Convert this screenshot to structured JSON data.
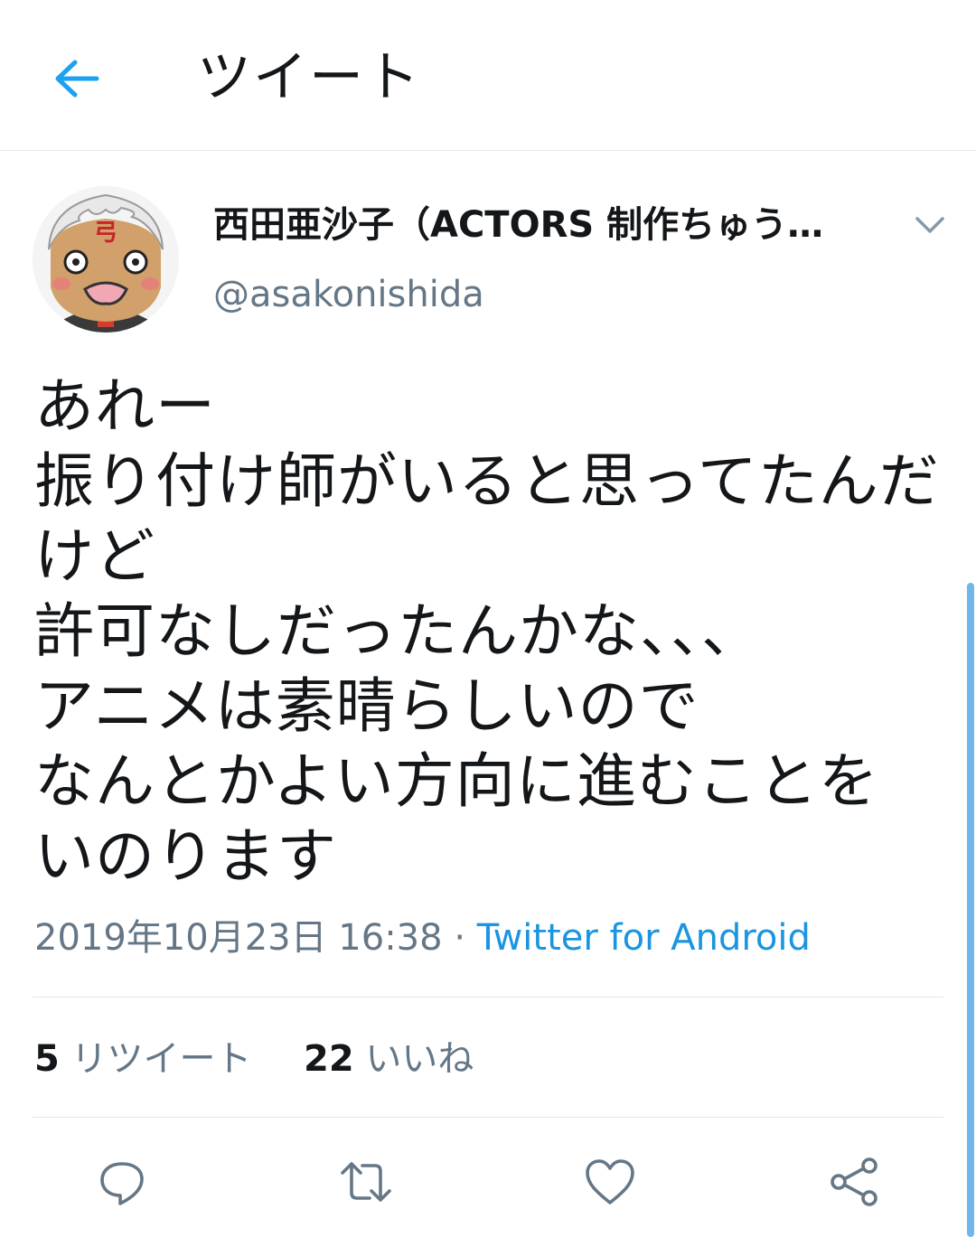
{
  "header": {
    "title": "ツイート",
    "back_icon": "arrow-left-icon"
  },
  "author": {
    "display_name": "西田亜沙子（ACTORS 制作ちゅう…",
    "handle": "@asakonishida"
  },
  "tweet": {
    "lines": [
      "あれー",
      "振り付け師がいると思ってたんだ",
      "けど",
      "許可なしだったんかな、、、",
      "アニメは素晴らしいので",
      "なんとかよい方向に進むことを",
      "いのります"
    ],
    "timestamp": "2019年10月23日 16:38",
    "separator": "·",
    "source": "Twitter for Android"
  },
  "stats": {
    "retweets": {
      "count": "5",
      "label": "リツイート"
    },
    "likes": {
      "count": "22",
      "label": "いいね"
    }
  },
  "colors": {
    "accent": "#1b95e0",
    "secondary_text": "#657786",
    "divider": "#e1e8ed",
    "scrollbar": "#6fb7ea"
  },
  "actions": [
    "reply-icon",
    "retweet-icon",
    "like-icon",
    "share-icon"
  ]
}
